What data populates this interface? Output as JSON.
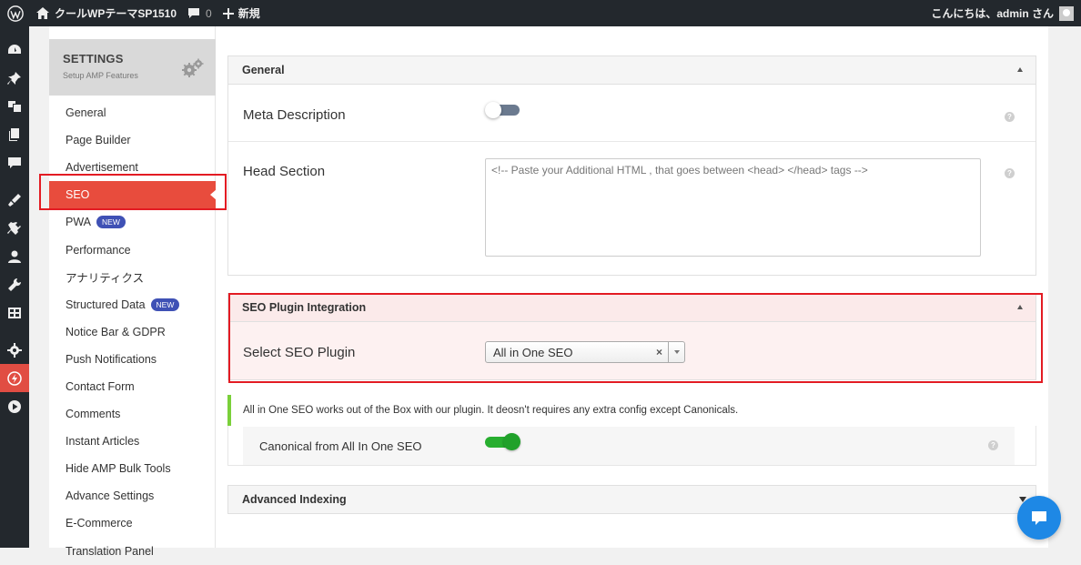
{
  "adminbar": {
    "site_name": "クールWPテーマSP1510",
    "comment_count": "0",
    "new_label": "新規",
    "greeting": "こんにちは、admin さん"
  },
  "settings": {
    "title": "SETTINGS",
    "subtitle": "Setup AMP Features",
    "nav": [
      {
        "label": "General"
      },
      {
        "label": "Page Builder"
      },
      {
        "label": "Advertisement"
      },
      {
        "label": "SEO",
        "active": true
      },
      {
        "label": "PWA",
        "badge": "NEW"
      },
      {
        "label": "Performance"
      },
      {
        "label": "アナリティクス"
      },
      {
        "label": "Structured Data",
        "badge": "NEW"
      },
      {
        "label": "Notice Bar & GDPR"
      },
      {
        "label": "Push Notifications"
      },
      {
        "label": "Contact Form"
      },
      {
        "label": "Comments"
      },
      {
        "label": "Instant Articles"
      },
      {
        "label": "Hide AMP Bulk Tools"
      },
      {
        "label": "Advance Settings"
      },
      {
        "label": "E-Commerce"
      },
      {
        "label": "Translation Panel"
      }
    ]
  },
  "general_section": {
    "title": "General",
    "meta_description_label": "Meta Description",
    "meta_description_enabled": false,
    "head_section_label": "Head Section",
    "head_section_placeholder": "<!-- Paste your Additional HTML , that goes between <head> </head> tags -->"
  },
  "seo_plugin_section": {
    "title": "SEO Plugin Integration",
    "select_label": "Select SEO Plugin",
    "selected_value": "All in One SEO",
    "clear_symbol": "×"
  },
  "notice": {
    "text": "All in One SEO works out of the Box with our plugin. It deosn't requires any extra config except Canonicals."
  },
  "canonical": {
    "label": "Canonical from All In One SEO",
    "enabled": true
  },
  "advanced_indexing": {
    "title": "Advanced Indexing"
  },
  "help_symbol": "?",
  "colors": {
    "active_nav": "#e84c3d",
    "highlight_outline": "#e31b23",
    "toggle_on": "#27ae2f",
    "badge": "#3f51b5",
    "chat": "#1e88e5"
  }
}
